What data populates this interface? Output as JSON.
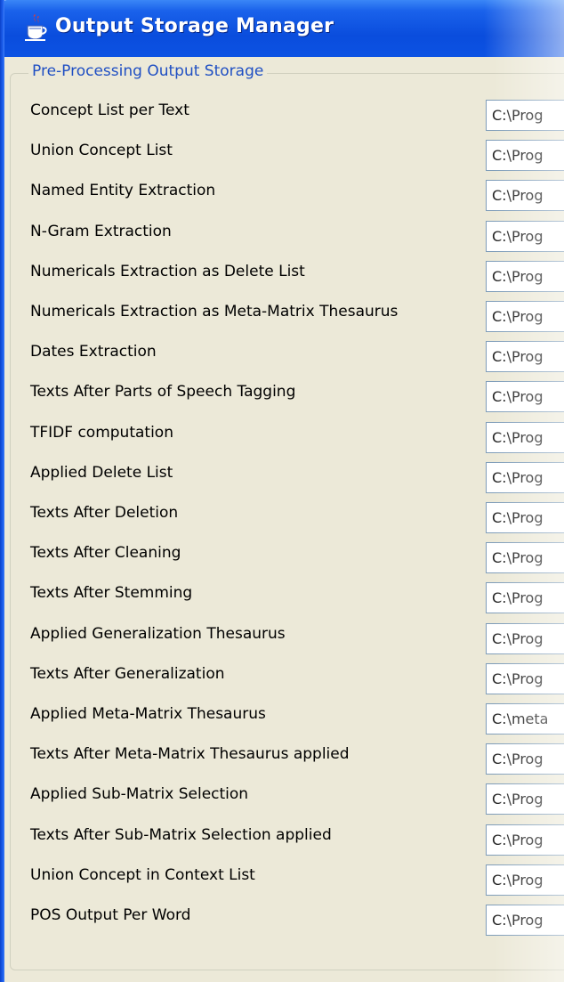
{
  "window": {
    "title": "Output Storage Manager",
    "icon": "java-cup-icon"
  },
  "group": {
    "title": "Pre-Processing Output Storage"
  },
  "rows": [
    {
      "label": "Concept List per Text",
      "value": "C:\\Prog"
    },
    {
      "label": "Union Concept List",
      "value": "C:\\Prog"
    },
    {
      "label": "Named Entity Extraction",
      "value": "C:\\Prog"
    },
    {
      "label": "N-Gram Extraction",
      "value": "C:\\Prog"
    },
    {
      "label": "Numericals Extraction as Delete List",
      "value": "C:\\Prog"
    },
    {
      "label": "Numericals Extraction as Meta-Matrix Thesaurus",
      "value": "C:\\Prog"
    },
    {
      "label": "Dates Extraction",
      "value": "C:\\Prog"
    },
    {
      "label": "Texts After Parts of Speech Tagging",
      "value": "C:\\Prog"
    },
    {
      "label": "TFIDF computation",
      "value": "C:\\Prog"
    },
    {
      "label": "Applied Delete List",
      "value": "C:\\Prog"
    },
    {
      "label": "Texts After Deletion",
      "value": "C:\\Prog"
    },
    {
      "label": "Texts After Cleaning",
      "value": "C:\\Prog"
    },
    {
      "label": "Texts After Stemming",
      "value": "C:\\Prog"
    },
    {
      "label": "Applied Generalization Thesaurus",
      "value": "C:\\Prog"
    },
    {
      "label": "Texts After Generalization",
      "value": "C:\\Prog"
    },
    {
      "label": "Applied Meta-Matrix Thesaurus",
      "value": "C:\\meta"
    },
    {
      "label": "Texts After Meta-Matrix Thesaurus applied",
      "value": "C:\\Prog"
    },
    {
      "label": "Applied Sub-Matrix Selection",
      "value": "C:\\Prog"
    },
    {
      "label": "Texts After Sub-Matrix Selection applied",
      "value": "C:\\Prog"
    },
    {
      "label": "Union Concept in Context List",
      "value": "C:\\Prog"
    },
    {
      "label": "POS Output Per Word",
      "value": "C:\\Prog"
    }
  ]
}
